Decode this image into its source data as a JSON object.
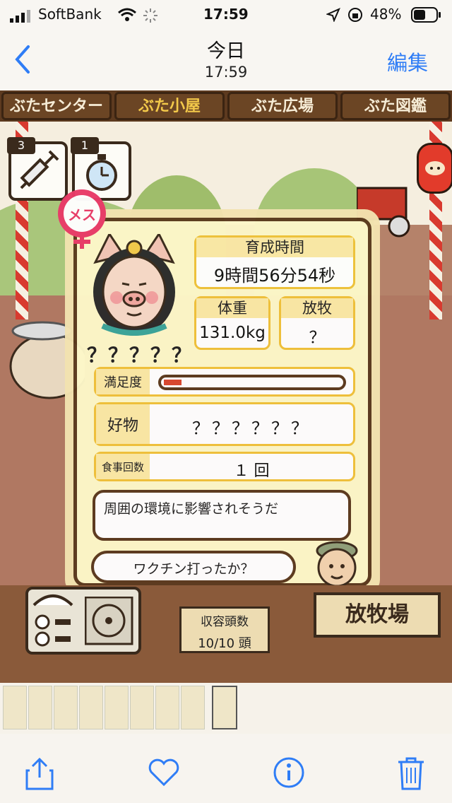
{
  "status": {
    "carrier": "SoftBank",
    "time": "17:59",
    "battery": "48%"
  },
  "nav": {
    "title": "今日",
    "subtitle": "17:59",
    "edit": "編集"
  },
  "tabs": [
    "ぶたセンター",
    "ぶた小屋",
    "ぶた広場",
    "ぶた図鑑"
  ],
  "badges": [
    {
      "count": "3",
      "icon": "syringe-icon"
    },
    {
      "count": "1",
      "icon": "stopwatch-icon"
    }
  ],
  "pig": {
    "gender": "メス",
    "name": "？？？？？",
    "rearing_time_label": "育成時間",
    "rearing_time": "9時間56分54秒",
    "weight_label": "体重",
    "weight": "131.0kg",
    "grazing_label": "放牧",
    "grazing": "？",
    "satisfaction_label": "満足度",
    "satisfaction_level": 0.1,
    "favorite_label": "好物",
    "favorite": "？？？？？？",
    "meals_label": "食事回数",
    "meals": "１ 回",
    "comment": "周囲の環境に影響されそうだ",
    "question": "ワクチン打ったか？"
  },
  "bottom": {
    "capacity_label": "収容頭数",
    "capacity": "10/10 頭",
    "pasture_sign": "放牧場"
  },
  "colors": {
    "accent": "#2f7df6",
    "frame": "#5b3a1e",
    "gold": "#f0c23a",
    "bar": "#d9472f"
  }
}
